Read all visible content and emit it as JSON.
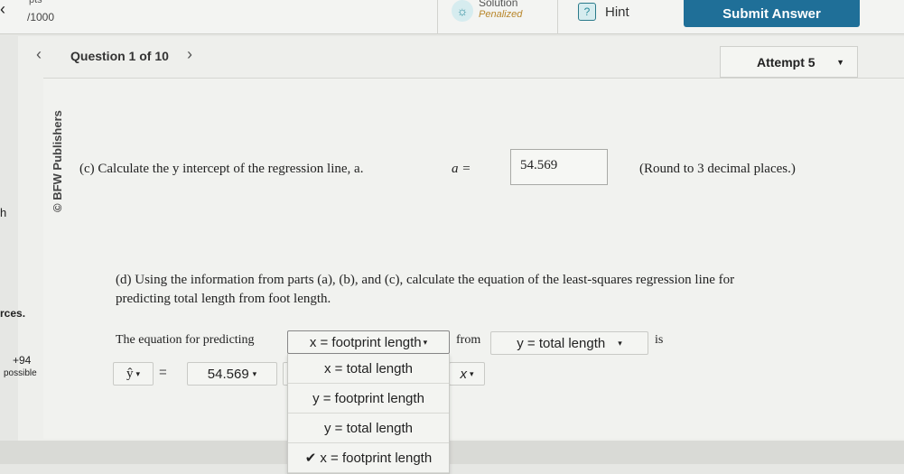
{
  "topbar": {
    "points_partial": "pts",
    "points_total": "/1000",
    "solution_label": "Solution",
    "solution_sub": "Penalized",
    "hint_label": "Hint",
    "submit_label": "Submit Answer"
  },
  "nav": {
    "question_label": "Question 1 of 10",
    "attempt_label": "Attempt 5"
  },
  "side": {
    "publisher": "© BFW Publishers",
    "frag_h": "h",
    "frag_rces": "rces.",
    "frag_points": "+94",
    "frag_possible": "possible"
  },
  "part_c": {
    "text": "(c) Calculate the y intercept of the regression line, a.",
    "var": "a =",
    "value": "54.569",
    "note": "(Round to 3 decimal places.)"
  },
  "part_d": {
    "line1": "(d) Using the information from parts (a), (b), and (c), calculate the equation of the least-squares regression line for",
    "line2": "predicting total length from foot length."
  },
  "equation": {
    "prefix": "The equation for predicting",
    "predict_select": "x = footprint length",
    "from": "from",
    "from_select": "y = total length",
    "is": "is",
    "lhs_select": "ŷ",
    "equals": "=",
    "intercept_select": "54.569",
    "x_select": "x"
  },
  "dropdown": {
    "options": [
      "x = total length",
      "y = footprint length",
      "y = total length",
      "x = footprint length"
    ],
    "selected_index": 3,
    "check": "✔"
  },
  "colors": {
    "accent": "#1f6f98",
    "penalized": "#b8862a"
  }
}
